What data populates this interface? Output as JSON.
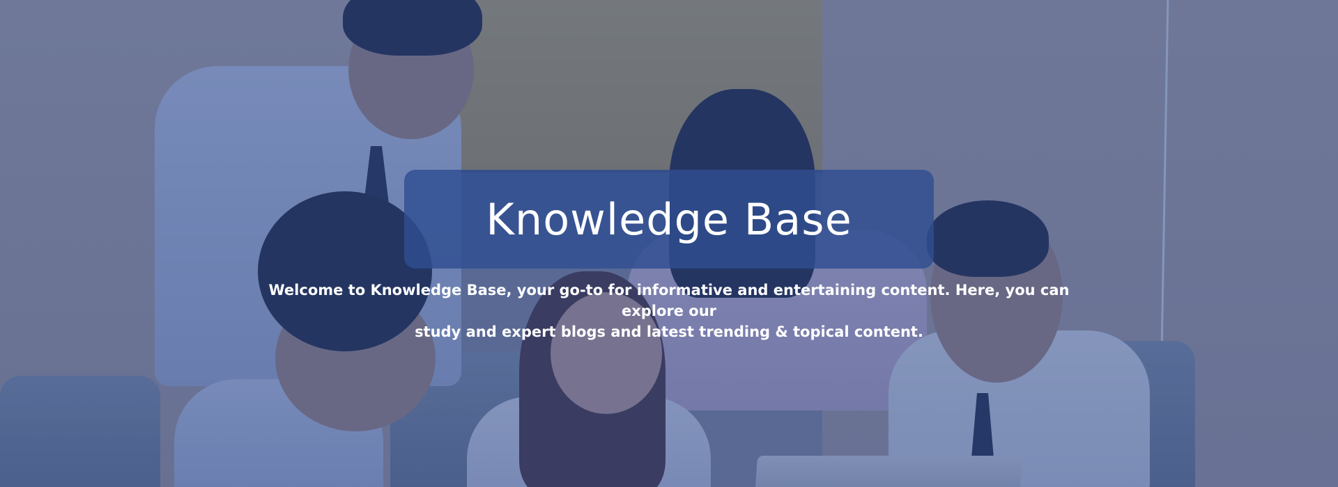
{
  "hero": {
    "title": "Knowledge Base",
    "description_line1": "Welcome to Knowledge Base, your go-to for informative and entertaining content. Here, you can explore our",
    "description_line2": "study and expert blogs and latest trending & topical content."
  },
  "colors": {
    "overlay": "#2d488c",
    "title_box": "#2f4e91",
    "text": "#ffffff"
  }
}
